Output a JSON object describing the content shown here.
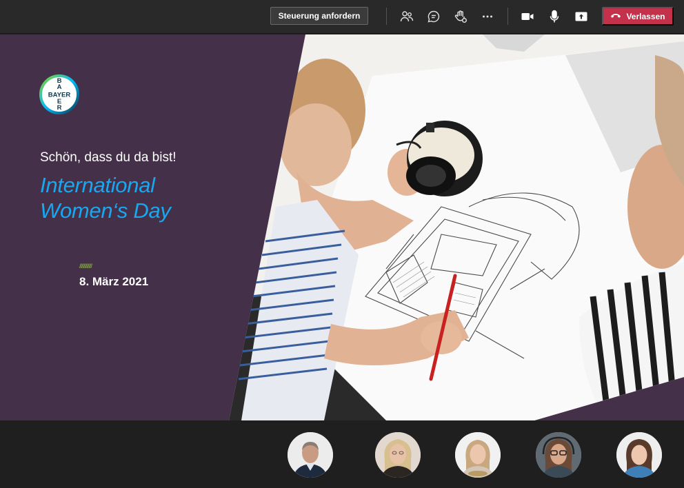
{
  "toolbar": {
    "request_control_label": "Steuerung anfordern",
    "icons": [
      "people-icon",
      "chat-icon",
      "raise-hand-icon",
      "more-options-icon",
      "camera-icon",
      "microphone-icon",
      "share-screen-icon"
    ],
    "leave_label": "Verlassen",
    "leave_color": "#c4314b"
  },
  "slide": {
    "logo_text": "BAYER",
    "greeting": "Schön, dass du da bist!",
    "title_line1": "International",
    "title_line2": "Women‘s Day",
    "accent_marks": "////////////",
    "date": "8. März 2021",
    "background_color": "#45304a",
    "title_color": "#17a8f0",
    "accent_color": "#8cbf3f"
  },
  "participants": [
    {
      "name": "participant-1"
    },
    {
      "name": "participant-2"
    },
    {
      "name": "participant-3"
    },
    {
      "name": "participant-4"
    },
    {
      "name": "participant-5"
    }
  ]
}
